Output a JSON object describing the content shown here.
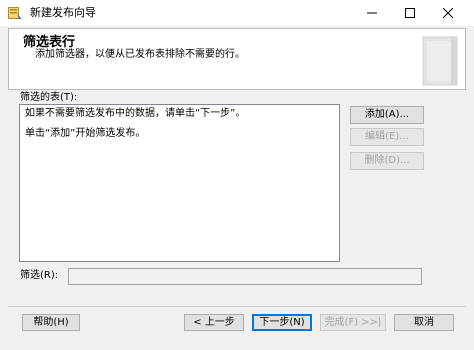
{
  "window": {
    "title": "新建发布向导",
    "icon": "wizard-app-icon"
  },
  "header": {
    "title": "筛选表行",
    "description": "添加筛选器，以便从已发布表排除不需要的行。"
  },
  "tables_section": {
    "label": "筛选的表(T):",
    "list_lines": [
      "如果不需要筛选发布中的数据，请单击“下一步”。",
      "单击“添加”开始筛选发布。"
    ]
  },
  "side_buttons": {
    "add": "添加(A)...",
    "edit": "编辑(E)...",
    "delete": "删除(D)..."
  },
  "filter": {
    "label": "筛选(R):",
    "value": ""
  },
  "footer_buttons": {
    "help": "帮助(H)",
    "back": "< 上一步",
    "next": "下一步(N)",
    "finish": "完成(F) >>|",
    "cancel": "取消"
  },
  "colors": {
    "accent": "#0078d7",
    "disabled_text": "#a0a0a0"
  }
}
